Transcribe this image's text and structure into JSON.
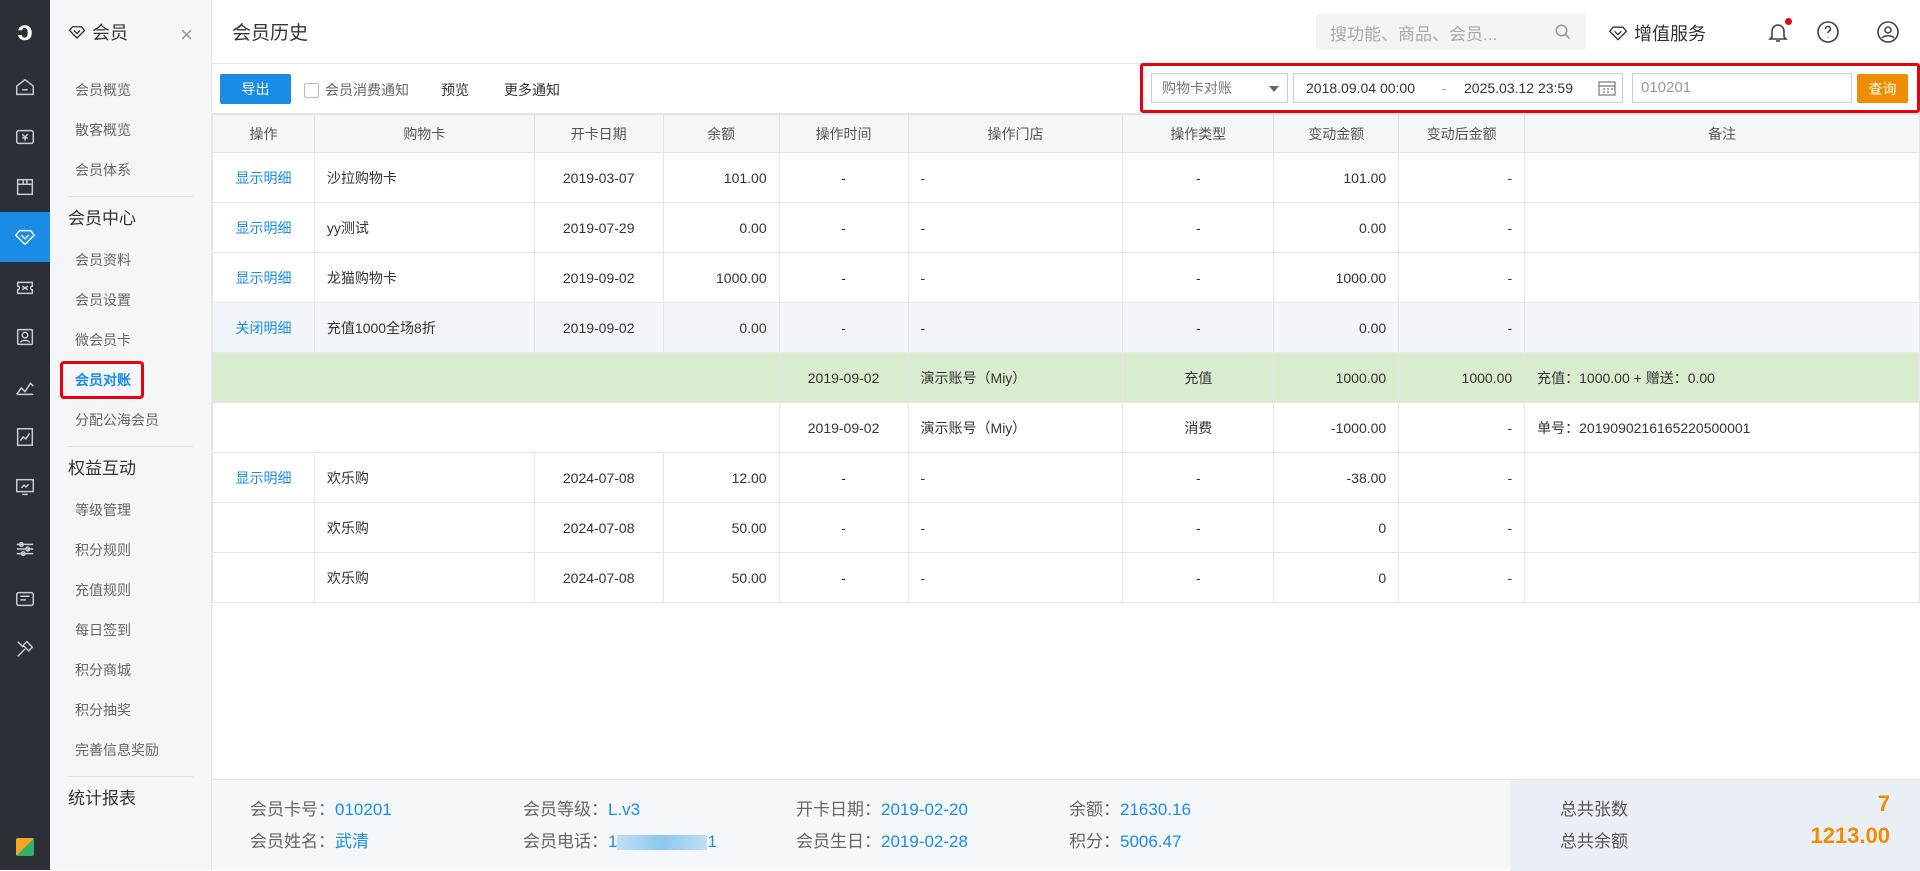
{
  "rail": {
    "logo": "ↄ",
    "active_index": 3
  },
  "sidebar": {
    "title": "会员",
    "close": "×",
    "groups": [
      {
        "items": [
          "会员概览",
          "散客概览",
          "会员体系"
        ]
      },
      {
        "title": "会员中心",
        "items": [
          "会员资料",
          "会员设置",
          "微会员卡",
          "会员对账",
          "分配公海会员"
        ]
      },
      {
        "title": "权益互动",
        "items": [
          "等级管理",
          "积分规则",
          "充值规则",
          "每日签到",
          "积分商城",
          "积分抽奖",
          "完善信息奖励"
        ]
      },
      {
        "title": "统计报表"
      }
    ]
  },
  "header": {
    "title": "会员历史",
    "search_placeholder": "搜功能、商品、会员...",
    "vas": "增值服务"
  },
  "toolbar": {
    "export": "导出",
    "notify": "会员消费通知",
    "preview": "预览",
    "more": "更多通知",
    "select": "购物卡对账",
    "date_from": "2018.09.04 00:00",
    "date_sep": "-",
    "date_to": "2025.03.12 23:59",
    "keyword": "010201",
    "query": "查询"
  },
  "table": {
    "headers": [
      "操作",
      "购物卡",
      "开卡日期",
      "余额",
      "操作时间",
      "操作门店",
      "操作类型",
      "变动金额",
      "变动后金额",
      "备注"
    ],
    "rows": [
      [
        "显示明细",
        "沙拉购物卡",
        "2019-03-07",
        "101.00",
        "-",
        "-",
        "-",
        "101.00",
        "-",
        ""
      ],
      [
        "显示明细",
        "yy测试",
        "2019-07-29",
        "0.00",
        "-",
        "-",
        "-",
        "0.00",
        "-",
        ""
      ],
      [
        "显示明细",
        "龙猫购物卡",
        "2019-09-02",
        "1000.00",
        "-",
        "-",
        "-",
        "1000.00",
        "-",
        ""
      ],
      [
        "关闭明细",
        "充值1000全场8折",
        "2019-09-02",
        "0.00",
        "-",
        "-",
        "-",
        "0.00",
        "-",
        ""
      ]
    ],
    "details": [
      [
        "2019-09-02",
        "演示账号（Miy）",
        "充值",
        "1000.00",
        "1000.00",
        "充值：1000.00 + 赠送：0.00"
      ],
      [
        "2019-09-02",
        "演示账号（Miy）",
        "消费",
        "-1000.00",
        "-",
        "单号：2019090216165220500001"
      ]
    ],
    "rows2": [
      [
        "显示明细",
        "欢乐购",
        "2024-07-08",
        "12.00",
        "-",
        "-",
        "-",
        "-38.00",
        "-",
        ""
      ],
      [
        "",
        "欢乐购",
        "2024-07-08",
        "50.00",
        "-",
        "-",
        "-",
        "0",
        "-",
        ""
      ],
      [
        "",
        "欢乐购",
        "2024-07-08",
        "50.00",
        "-",
        "-",
        "-",
        "0",
        "-",
        ""
      ]
    ]
  },
  "footer": {
    "card_no_label": "会员卡号：",
    "card_no": "010201",
    "level_label": "会员等级：",
    "level": "L.v3",
    "open_label": "开卡日期：",
    "open": "2019-02-20",
    "balance_label": "余额：",
    "balance": "21630.16",
    "name_label": "会员姓名：",
    "name": "武清",
    "phone_label": "会员电话：",
    "phone_start": "1",
    "phone_end": "1",
    "birthday_label": "会员生日：",
    "birthday": "2019-02-28",
    "points_label": "积分：",
    "points": "5006.47",
    "total_cards_label": "总共张数",
    "total_cards": "7",
    "total_balance_label": "总共余额",
    "total_balance": "1213.00"
  }
}
